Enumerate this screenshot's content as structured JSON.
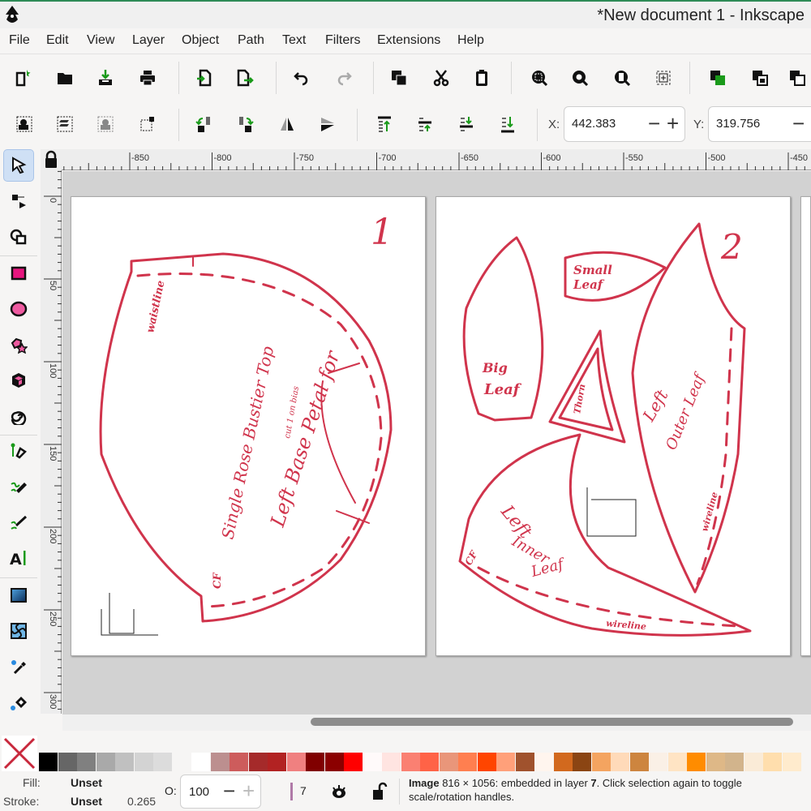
{
  "window": {
    "title": "*New document 1 - Inkscape"
  },
  "menu": [
    "File",
    "Edit",
    "View",
    "Layer",
    "Object",
    "Path",
    "Text",
    "Filters",
    "Extensions",
    "Help"
  ],
  "toolbar1": [
    "new-document",
    "open",
    "import",
    "print",
    "import-doc",
    "export",
    "undo",
    "redo",
    "duplicate",
    "cut",
    "paste",
    "zoom-selection",
    "zoom-drawing",
    "zoom-page",
    "zoom-center",
    "group-fill",
    "lock-layer",
    "unlock-layer"
  ],
  "toolbar2": {
    "x_label": "X:",
    "x_value": "442.383",
    "y_label": "Y:",
    "y_value": "319.756",
    "minus": "−",
    "plus": "+"
  },
  "tools": [
    "selector",
    "node",
    "tweak",
    "rectangle",
    "ellipse",
    "star",
    "3d-box",
    "spiral",
    "pen",
    "pencil",
    "calligraphy",
    "text",
    "gradient",
    "mesh",
    "dropper",
    "paint-bucket"
  ],
  "ruler": {
    "h_labels": [
      "-850",
      "-800",
      "-750",
      "-700",
      "-650",
      "-600",
      "-550",
      "-500",
      "-450"
    ],
    "v_labels": [
      "0",
      "50",
      "100",
      "150",
      "200",
      "250",
      "300"
    ]
  },
  "pages": {
    "page1": {
      "number": "1",
      "title1": "Left Base Petal for",
      "title2": "Single Rose Bustier Top",
      "cf": "CF",
      "waist": "waistline",
      "sub": "cut 1 on bias"
    },
    "page2": {
      "number": "2",
      "small_leaf1": "Small",
      "small_leaf2": "Leaf",
      "big_leaf1": "Big",
      "big_leaf2": "Leaf",
      "thorn": "Thorn",
      "outer1": "Left",
      "outer2": "Outer Leaf",
      "inner1": "Left",
      "inner2": "Inner",
      "inner3": "Leaf",
      "wireline": "wireline",
      "wireline2": "wireline",
      "cf": "CF"
    }
  },
  "palette": [
    "#000000",
    "#666666",
    "#808080",
    "#a9a9a9",
    "#c0c0c0",
    "#d3d3d3",
    "#dcdcdc",
    null,
    "#ffffff",
    "#bc8f8f",
    "#cd5c5c",
    "#a52a2a",
    "#b22222",
    "#f08080",
    "#800000",
    "#8b0000",
    "#ff0000",
    "#fffafa",
    "#ffe4e1",
    "#fa8072",
    "#ff6347",
    "#e9967a",
    "#ff7f50",
    "#ff4500",
    "#ffa07a",
    "#a0522d",
    "#fff5ee",
    "#d2691e",
    "#8b4513",
    "#f4a460",
    "#ffdab9",
    "#cd853f",
    "#faf0e6",
    "#ffe4c4",
    "#ff8c00",
    "#deb887",
    "#d2b48c",
    "#faebd7",
    "#ffdead",
    "#ffebcd"
  ],
  "status": {
    "fill_label": "Fill:",
    "fill_value": "Unset",
    "stroke_label": "Stroke:",
    "stroke_value": "Unset",
    "stroke_width": "0.265",
    "opacity_label": "O:",
    "opacity_value": "100",
    "layer": "7",
    "msg_bold": "Image",
    "msg_1": " 816 × 1056: embedded in layer ",
    "msg_layer": "7",
    "msg_2": ". Click selection again to toggle scale/rotation handles."
  },
  "colors": {
    "ink": "#d0344c",
    "accent": "#2e8b57"
  }
}
